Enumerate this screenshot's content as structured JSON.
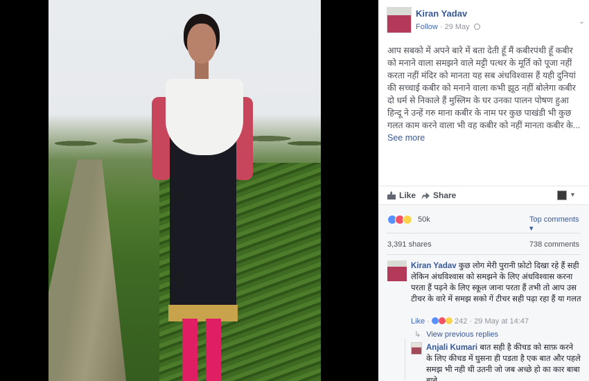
{
  "post": {
    "author": "Kiran Yadav",
    "follow_label": "Follow",
    "date": "29 May",
    "text": "आप सबको में अपने बारे में बता देती हूँ मैं कबीरपंथी हूँ कबीर को मनाने वाला समझने वाले मट्टी पत्थर के मूर्ति को पूजा नहीं करता नहीं मंदिर को मानता यह सब अंधविश्वास हैं यही दुनियां की सच्चाई कबीर को मनाने वाला कभी झूठ नहीं बोलेगा कबीर दो धर्म से निकाले हैं मुस्लिम के घर उनका पालन पोषण हुआ हिन्दू ने उन्हें गरु माना कबीर के नाम पर कुछ पाखंडी भी कुछ गलत काम करने वाला भी वह कबीर को नहीं मानता कबीर के...",
    "see_more": "See more"
  },
  "actions": {
    "like_label": "Like",
    "share_label": "Share"
  },
  "feedback": {
    "reaction_count": "50k",
    "top_comments_label": "Top comments ▾",
    "shares": "3,391 shares",
    "comments": "738 comments"
  },
  "comment": {
    "author": "Kiran Yadav",
    "text": "कुछ लोग मेरी पुरानी फ़ोटो दिखा रहे हैं सही लेकिन अंधविश्वास को समझने के लिए अंधविश्वास करना परता हैं पढ़ने के लिए स्कूल जाना परता हैं तभी तो आप उस टीचर के वारे में समझ सको गें टीचर सही पढ़ा रहा हैं या गलत",
    "like_label": "Like",
    "separator": "·",
    "reaction_count": "242",
    "timestamp": "· 29 May at 14:47"
  },
  "replies": {
    "view_previous": "View previous replies",
    "reply_author": "Anjali Kumari",
    "reply_text": "बात सही है कीचड को साफ़ करने के लिए कीचड में घुसना ही पडता है एक बात और पहले समझ भी नही थी उतनी जो जब अच्छे हो का कार बाबा बाबे"
  }
}
